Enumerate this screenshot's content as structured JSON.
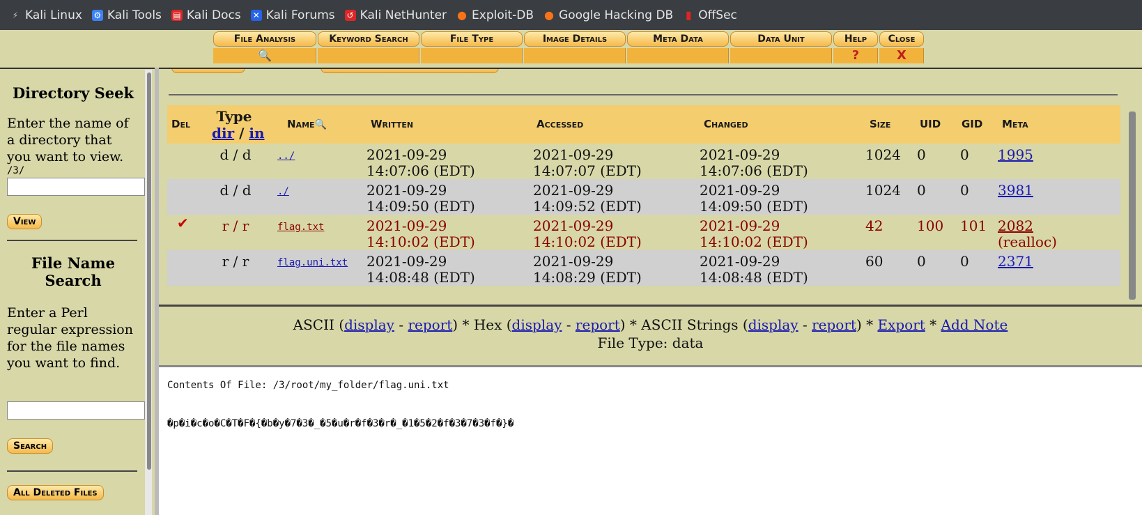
{
  "bookmarks": [
    {
      "label": "Kali Linux",
      "icon": "kali-dragon-icon",
      "color": "#cccccc"
    },
    {
      "label": "Kali Tools",
      "icon": "kali-tools-icon",
      "color": "#3b82f6"
    },
    {
      "label": "Kali Docs",
      "icon": "kali-docs-icon",
      "color": "#dc2626"
    },
    {
      "label": "Kali Forums",
      "icon": "kali-forums-icon",
      "color": "#2563eb"
    },
    {
      "label": "Kali NetHunter",
      "icon": "nethunter-icon",
      "color": "#dc2626"
    },
    {
      "label": "Exploit-DB",
      "icon": "exploit-db-icon",
      "color": "#f97316"
    },
    {
      "label": "Google Hacking DB",
      "icon": "ghdb-icon",
      "color": "#f97316"
    },
    {
      "label": "OffSec",
      "icon": "offsec-icon",
      "color": "#dc2626"
    }
  ],
  "toolbar": {
    "file_analysis": "File Analysis",
    "keyword_search": "Keyword Search",
    "file_type": "File Type",
    "image_details": "Image Details",
    "meta_data": "Meta Data",
    "data_unit": "Data Unit",
    "help": "Help",
    "help_glyph": "?",
    "close": "Close",
    "close_glyph": "X"
  },
  "sidebar": {
    "dir_seek_title": "Directory Seek",
    "dir_seek_text": "Enter the name of a directory that you want to view.",
    "dir_path": "/3/",
    "view_button": "View",
    "file_search_title": "File Name Search",
    "file_search_text": "Enter a Perl regular expression for the file names you want to find.",
    "search_button": "Search",
    "all_deleted_button": "All Deleted Files"
  },
  "file_list": {
    "headers": {
      "del": "Del",
      "type": "Type",
      "type_dir": "dir",
      "type_sep": "/",
      "type_in": "in",
      "name": "Name",
      "written": "Written",
      "accessed": "Accessed",
      "changed": "Changed",
      "size": "Size",
      "uid": "UID",
      "gid": "GID",
      "meta": "Meta"
    },
    "rows": [
      {
        "del": "",
        "type": "d / d",
        "name": "../",
        "written_date": "2021-09-29",
        "written_time": "14:07:06 (EDT)",
        "accessed_date": "2021-09-29",
        "accessed_time": "14:07:07 (EDT)",
        "changed_date": "2021-09-29",
        "changed_time": "14:07:06 (EDT)",
        "size": "1024",
        "uid": "0",
        "gid": "0",
        "meta": "1995",
        "meta_note": ""
      },
      {
        "del": "",
        "type": "d / d",
        "name": "./",
        "written_date": "2021-09-29",
        "written_time": "14:09:50 (EDT)",
        "accessed_date": "2021-09-29",
        "accessed_time": "14:09:52 (EDT)",
        "changed_date": "2021-09-29",
        "changed_time": "14:09:50 (EDT)",
        "size": "1024",
        "uid": "0",
        "gid": "0",
        "meta": "3981",
        "meta_note": ""
      },
      {
        "del": "✔",
        "type": "r / r",
        "name": "flag.txt",
        "written_date": "2021-09-29",
        "written_time": "14:10:02 (EDT)",
        "accessed_date": "2021-09-29",
        "accessed_time": "14:10:02 (EDT)",
        "changed_date": "2021-09-29",
        "changed_time": "14:10:02 (EDT)",
        "size": "42",
        "uid": "100",
        "gid": "101",
        "meta": "2082",
        "meta_note": "(realloc)"
      },
      {
        "del": "",
        "type": "r / r",
        "name": "flag.uni.txt",
        "written_date": "2021-09-29",
        "written_time": "14:08:48 (EDT)",
        "accessed_date": "2021-09-29",
        "accessed_time": "14:08:29 (EDT)",
        "changed_date": "2021-09-29",
        "changed_time": "14:08:48 (EDT)",
        "size": "60",
        "uid": "0",
        "gid": "0",
        "meta": "2371",
        "meta_note": ""
      }
    ]
  },
  "actions": {
    "ascii": "ASCII (",
    "display": "display",
    "dash": " - ",
    "report": "report",
    "close_star": ") * ",
    "hex": "Hex (",
    "ascii_strings": "ASCII Strings (",
    "export": "Export",
    "star": " * ",
    "add_note": "Add Note",
    "file_type": "File Type: data"
  },
  "content": {
    "header": "Contents Of File: /3/root/my_folder/flag.uni.txt",
    "body": "�p�i�c�o�C�T�F�{�b�y�7�3�_�5�u�r�f�3�r�_�1�5�2�f�3�7�3�f�}�"
  },
  "colors": {
    "bg": "#d7d7a8",
    "header_row": "#f4cd6e",
    "alt_row": "#d0d0d0",
    "deleted_text": "#8b0000",
    "link": "#1a1ab0"
  }
}
